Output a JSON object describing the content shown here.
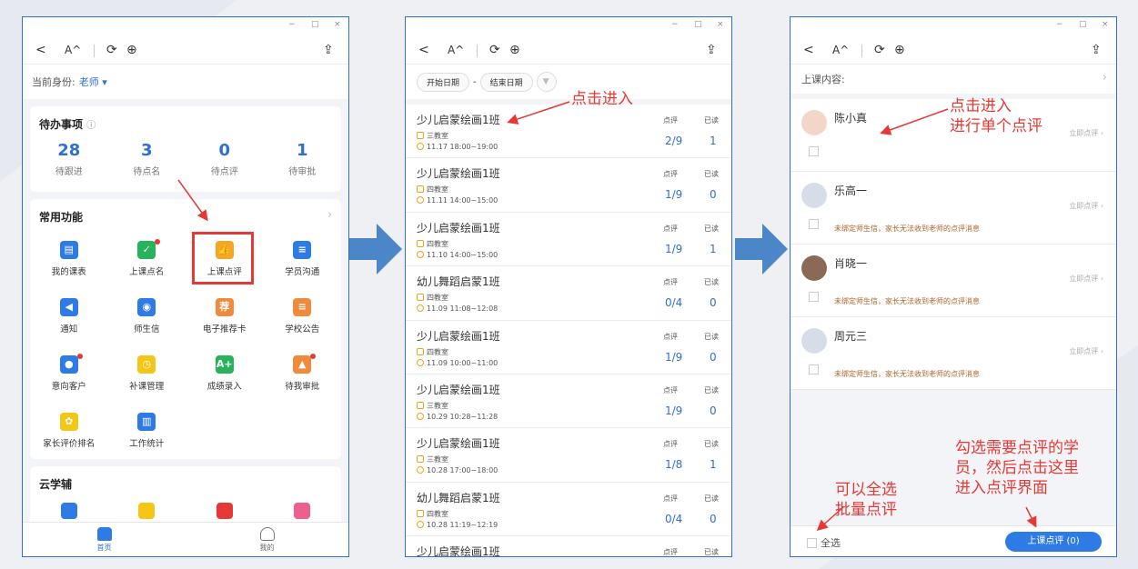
{
  "window_controls": {
    "min": "−",
    "max": "□",
    "close": "×"
  },
  "toolbar": {
    "back": "<",
    "font": "A^",
    "refresh": "⟳",
    "globe": "⊕",
    "share": "⇪"
  },
  "panel1": {
    "role_label": "当前身份:",
    "role_value": "老师",
    "todo_title": "待办事项",
    "todo_stats": [
      {
        "value": "28",
        "label": "待跟进"
      },
      {
        "value": "3",
        "label": "待点名"
      },
      {
        "value": "0",
        "label": "待点评"
      },
      {
        "value": "1",
        "label": "待审批"
      }
    ],
    "features_title": "常用功能",
    "features": [
      {
        "label": "我的课表",
        "icon": "calendar-icon",
        "color": "#2f7be5",
        "glyph": "▤",
        "dot": false
      },
      {
        "label": "上课点名",
        "icon": "check-calendar-icon",
        "color": "#26b35a",
        "glyph": "✓",
        "dot": true
      },
      {
        "label": "上课点评",
        "icon": "thumbs-up-icon",
        "color": "#f5a623",
        "glyph": "👍",
        "dot": false
      },
      {
        "label": "学员沟通",
        "icon": "chat-icon",
        "color": "#2f7be5",
        "glyph": "≡",
        "dot": false
      },
      {
        "label": "通知",
        "icon": "megaphone-icon",
        "color": "#2f7be5",
        "glyph": "◀",
        "dot": false
      },
      {
        "label": "师生信",
        "icon": "letter-icon",
        "color": "#2f7be5",
        "glyph": "◉",
        "dot": false
      },
      {
        "label": "电子推荐卡",
        "icon": "recommend-card-icon",
        "color": "#f08a3c",
        "glyph": "荐",
        "dot": false
      },
      {
        "label": "学校公告",
        "icon": "announcement-icon",
        "color": "#f08a3c",
        "glyph": "≡",
        "dot": false
      },
      {
        "label": "意向客户",
        "icon": "customer-icon",
        "color": "#2f7be5",
        "glyph": "●",
        "dot": true
      },
      {
        "label": "补课管理",
        "icon": "makeup-class-icon",
        "color": "#f5c518",
        "glyph": "◷",
        "dot": false
      },
      {
        "label": "成绩录入",
        "icon": "grade-icon",
        "color": "#26b35a",
        "glyph": "A+",
        "dot": false
      },
      {
        "label": "待我审批",
        "icon": "approval-stamp-icon",
        "color": "#f08a3c",
        "glyph": "▲",
        "dot": true
      },
      {
        "label": "家长评价排名",
        "icon": "lotus-icon",
        "color": "#f5c518",
        "glyph": "✿",
        "dot": false
      },
      {
        "label": "工作统计",
        "icon": "stats-board-icon",
        "color": "#2f7be5",
        "glyph": "▥",
        "dot": false
      }
    ],
    "cloud_title": "云学辅",
    "nav": [
      {
        "label": "首页"
      },
      {
        "label": "我的"
      }
    ]
  },
  "panel2": {
    "start_date": "开始日期",
    "dash": "-",
    "end_date": "结束日期",
    "col_comment": "点评",
    "col_read": "已读",
    "rows": [
      {
        "name": "少儿启蒙绘画1班",
        "room": "三教室",
        "time": "11.17    18:00~19:00",
        "comment": "2/9",
        "read": "1"
      },
      {
        "name": "少儿启蒙绘画1班",
        "room": "四教室",
        "time": "11.11    14:00~15:00",
        "comment": "1/9",
        "read": "0"
      },
      {
        "name": "少儿启蒙绘画1班",
        "room": "四教室",
        "time": "11.10    14:00~15:00",
        "comment": "1/9",
        "read": "1"
      },
      {
        "name": "幼儿舞蹈启蒙1班",
        "room": "四教室",
        "time": "11.09    11:08~12:08",
        "comment": "0/4",
        "read": "0"
      },
      {
        "name": "少儿启蒙绘画1班",
        "room": "四教室",
        "time": "11.09    10:00~11:00",
        "comment": "1/9",
        "read": "0"
      },
      {
        "name": "少儿启蒙绘画1班",
        "room": "三教室",
        "time": "10.29    10:28~11:28",
        "comment": "1/9",
        "read": "0"
      },
      {
        "name": "少儿启蒙绘画1班",
        "room": "三教室",
        "time": "10.28    17:00~18:00",
        "comment": "1/8",
        "read": "1"
      },
      {
        "name": "幼儿舞蹈启蒙1班",
        "room": "四教室",
        "time": "10.28    11:19~12:19",
        "comment": "0/4",
        "read": "0"
      },
      {
        "name": "少儿启蒙绘画1班",
        "room": "",
        "time": "",
        "comment": "",
        "read": ""
      }
    ]
  },
  "panel3": {
    "content_label": "上课内容:",
    "rate_label": "立即点评",
    "warn_text": "未绑定师生信，家长无法收到老师的点评消息",
    "students": [
      {
        "name": "陈小真",
        "warn": false,
        "avatar_color": "#f3d6c8"
      },
      {
        "name": "乐高一",
        "warn": true,
        "avatar_color": "#d7dde8"
      },
      {
        "name": "肖晓一",
        "warn": true,
        "avatar_color": "#8a6a55"
      },
      {
        "name": "周元三",
        "warn": true,
        "avatar_color": "#d7dde8"
      }
    ],
    "select_all": "全选",
    "submit": "上课点评 (0)"
  },
  "annotations": {
    "a1": "点击进入",
    "a2_line1": "点击进入",
    "a2_line2": "进行单个点评",
    "a3_line1": "可以全选",
    "a3_line2": "批量点评",
    "a4_line1": "勾选需要点评的学",
    "a4_line2": "员，然后点击这里",
    "a4_line3": "进入点评界面"
  },
  "colors": {
    "accent": "#2f7be5",
    "annotation": "#e53935",
    "flow_arrow": "#4a86c8"
  }
}
